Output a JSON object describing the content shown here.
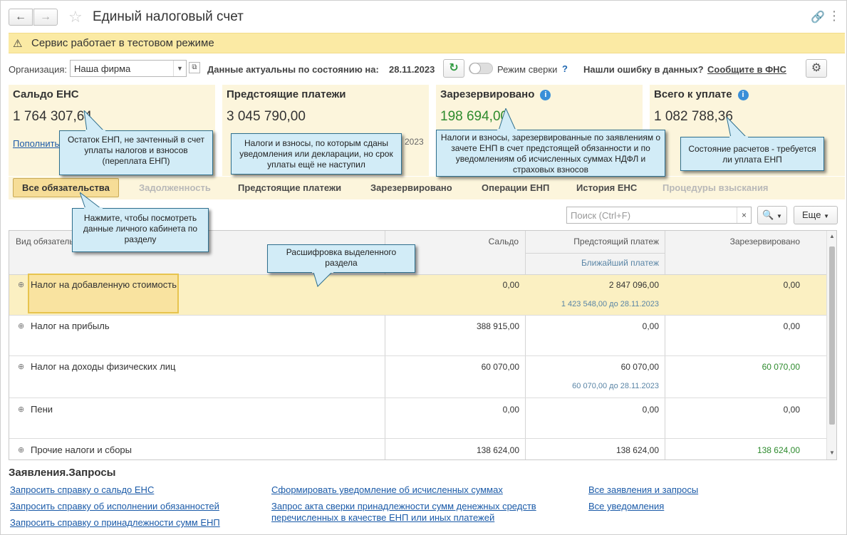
{
  "window": {
    "title": "Единый налоговый счет"
  },
  "warning": {
    "text": "Сервис работает в тестовом режиме"
  },
  "org": {
    "label": "Организация:",
    "value": "Наша фирма",
    "actual_label": "Данные актуальны по состоянию на:",
    "actual_date": "28.11.2023",
    "reconcile_label": "Режим сверки",
    "help_mark": "?",
    "error_label": "Нашли ошибку в данных?",
    "error_link": "Сообщите в ФНС"
  },
  "cards": {
    "saldo": {
      "title": "Сальдо ЕНС",
      "value": "1 764 307,64",
      "link": "Пополнить"
    },
    "upcoming": {
      "title": "Предстоящие платежи",
      "value": "3 045 790,00",
      "extra": "2023"
    },
    "reserved": {
      "title": "Зарезервировано",
      "value": "198 694,00",
      "info": "i"
    },
    "topay": {
      "title": "Всего к уплате",
      "value": "1 082 788,36",
      "info": "i"
    }
  },
  "callouts": {
    "saldo": "Остаток ЕНП, не зачтенный в счет уплаты налогов и взносов (переплата ЕНП)",
    "upcoming": "Налоги и взносы, по которым сданы уведомления или декларации, но срок уплаты ещё не наступил",
    "reserved": "Налоги и взносы, зарезервированные по заявлениям о зачете ЕНП в счет предстоящей обязанности и по уведомлениям об исчисленных суммах НДФЛ и страховых взносов",
    "topay": "Состояние расчетов - требуется ли уплата ЕНП",
    "tabs": "Нажмите, чтобы посмотреть данные личного кабинета по разделу",
    "table": "Расшифровка выделенного раздела"
  },
  "tabs": [
    {
      "label": "Все обязательства",
      "state": "active"
    },
    {
      "label": "Задолженность",
      "state": "disabled"
    },
    {
      "label": "Предстоящие платежи",
      "state": "normal"
    },
    {
      "label": "Зарезервировано",
      "state": "normal"
    },
    {
      "label": "Операции ЕНП",
      "state": "normal"
    },
    {
      "label": "История ЕНС",
      "state": "normal"
    },
    {
      "label": "Процедуры взыскания",
      "state": "disabled"
    }
  ],
  "search": {
    "placeholder": "Поиск (Ctrl+F)",
    "clear": "×",
    "more_label": "Еще"
  },
  "table": {
    "headers": {
      "kind": "Вид обязательства",
      "saldo": "Сальдо",
      "upcoming": "Предстоящий платеж",
      "nearest": "Ближайший платеж",
      "reserved": "Зарезервировано"
    },
    "rows": [
      {
        "name": "Налог на добавленную стоимость",
        "saldo": "0,00",
        "upcoming": "2 847 096,00",
        "nearest": "1 423 548,00 до 28.11.2023",
        "reserved": "0,00"
      },
      {
        "name": "Налог на прибыль",
        "saldo": "388 915,00",
        "upcoming": "0,00",
        "nearest": "",
        "reserved": "0,00"
      },
      {
        "name": "Налог на доходы физических лиц",
        "saldo": "60 070,00",
        "upcoming": "60 070,00",
        "nearest": "60 070,00 до 28.11.2023",
        "reserved": "60 070,00"
      },
      {
        "name": "Пени",
        "saldo": "0,00",
        "upcoming": "0,00",
        "nearest": "",
        "reserved": "0,00"
      },
      {
        "name": "Прочие налоги и сборы",
        "saldo": "138 624,00",
        "upcoming": "138 624,00",
        "nearest": "",
        "reserved": "138 624,00"
      }
    ]
  },
  "requests": {
    "title": "Заявления.Запросы",
    "links": [
      "Запросить справку о сальдо ЕНС",
      "Запросить справку об исполнении обязанностей",
      "Запросить справку о принадлежности сумм ЕНП",
      "Сформировать уведомление об исчисленных суммах",
      "Запрос акта сверки принадлежности сумм денежных средств перечисленных в качестве ЕНП или иных платежей",
      "Все заявления и запросы",
      "Все уведомления"
    ]
  },
  "colors": {
    "accent_yellow": "#fbeaa4",
    "card_bg": "#fcf5dc",
    "callout_bg": "#d2ecf7",
    "link": "#1a5aa8",
    "green": "#2e8b2e"
  }
}
